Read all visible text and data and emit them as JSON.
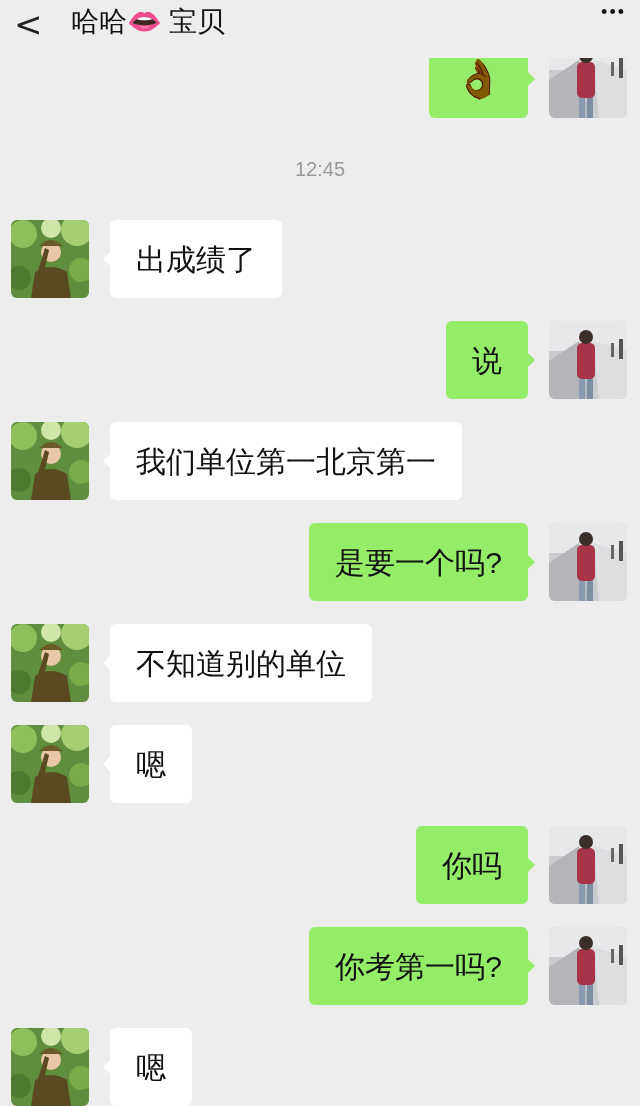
{
  "header": {
    "back": "<",
    "title": "哈哈👄 宝贝",
    "more": "•••"
  },
  "messages": [
    {
      "kind": "sent_emoji",
      "text": "👌"
    },
    {
      "kind": "time",
      "text": "12:45"
    },
    {
      "kind": "received",
      "text": "出成绩了"
    },
    {
      "kind": "sent",
      "text": "说"
    },
    {
      "kind": "received",
      "text": "我们单位第一北京第一"
    },
    {
      "kind": "sent",
      "text": "是要一个吗?"
    },
    {
      "kind": "received",
      "text": "不知道别的单位"
    },
    {
      "kind": "received",
      "text": "嗯"
    },
    {
      "kind": "sent",
      "text": "你吗"
    },
    {
      "kind": "sent",
      "text": "你考第一吗?"
    },
    {
      "kind": "received",
      "text": "嗯"
    }
  ]
}
